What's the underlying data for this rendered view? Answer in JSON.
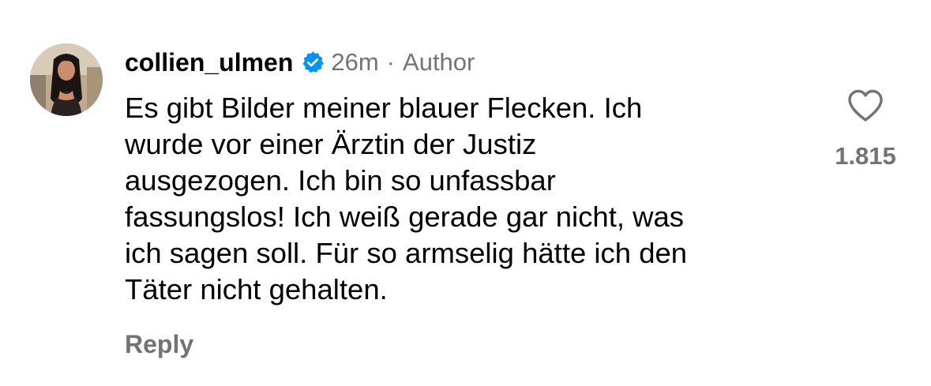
{
  "comment": {
    "username": "collien_ulmen",
    "verified": true,
    "time": "26m",
    "separator": "·",
    "role_label": "Author",
    "text_lines": [
      "Es gibt Bilder meiner blauer Flecken. Ich",
      "wurde vor einer Ärztin der Justiz",
      "ausgezogen. Ich bin so unfassbar",
      "fassungslos! Ich weiß gerade gar nicht, was",
      "ich sagen soll. Für so armselig hätte ich den",
      "Täter nicht gehalten."
    ],
    "like_count": "1.815",
    "reply_label": "Reply"
  },
  "icons": {
    "avatar": "profile-photo",
    "verified": "verified-badge-icon",
    "like": "heart-outline-icon"
  },
  "colors": {
    "text": "#000000",
    "secondary_text": "#737373",
    "verified_blue": "#0095F6",
    "background": "#FFFFFF"
  }
}
